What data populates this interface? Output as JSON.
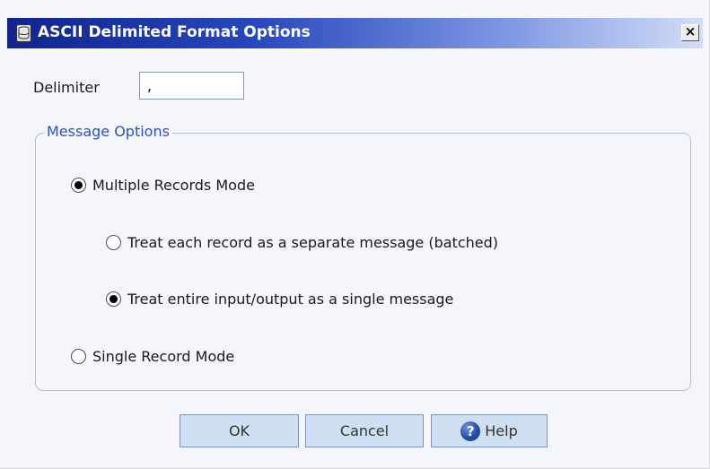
{
  "window": {
    "title": "ASCII Delimited Format Options",
    "icon": "database-icon",
    "close_label": "×"
  },
  "delimiter": {
    "label": "Delimiter",
    "value": ","
  },
  "message_options": {
    "legend": "Message Options",
    "multiple_records": {
      "label": "Multiple Records Mode",
      "checked": true,
      "batched": {
        "label": "Treat each record as a separate message (batched)",
        "checked": false
      },
      "single_message": {
        "label": "Treat entire input/output as a single message",
        "checked": true
      }
    },
    "single_record": {
      "label": "Single Record Mode",
      "checked": false
    }
  },
  "buttons": {
    "ok": "OK",
    "cancel": "Cancel",
    "help": "Help",
    "help_icon": "question-icon",
    "help_icon_glyph": "?"
  },
  "colors": {
    "titlebar_start": "#10248f",
    "titlebar_end": "#d3ddf6",
    "legend_text": "#2b4fcf",
    "button_bg": "#cfe0f2"
  }
}
